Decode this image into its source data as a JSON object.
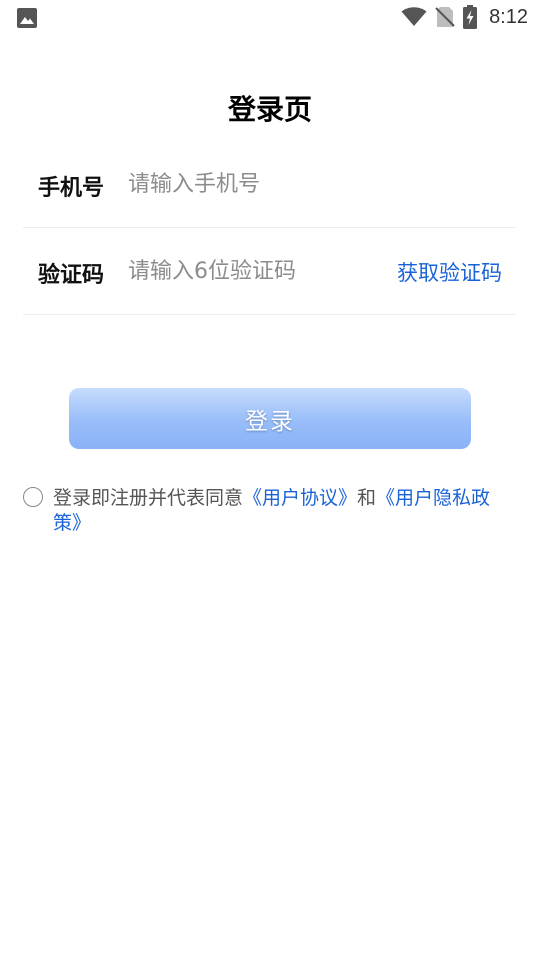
{
  "status_bar": {
    "time": "8:12",
    "icons": [
      "image-icon",
      "wifi-icon",
      "no-sim-icon",
      "battery-charging-icon"
    ]
  },
  "page": {
    "title": "登录页"
  },
  "form": {
    "phone_label": "手机号",
    "phone_placeholder": "请输入手机号",
    "code_label": "验证码",
    "code_placeholder": "请输入6位验证码",
    "get_code_label": "获取验证码"
  },
  "login_button": {
    "label": "登录"
  },
  "agreement": {
    "prefix": "登录即注册并代表同意",
    "user_agreement": "《用户协议》",
    "conjunction": "和",
    "privacy_policy": "《用户隐私政策》"
  },
  "colors": {
    "accent": "#1a63d6",
    "button_gradient_top": "#c6dcfd",
    "button_gradient_bottom": "#8ab2f7",
    "placeholder": "#8c8c8c"
  }
}
